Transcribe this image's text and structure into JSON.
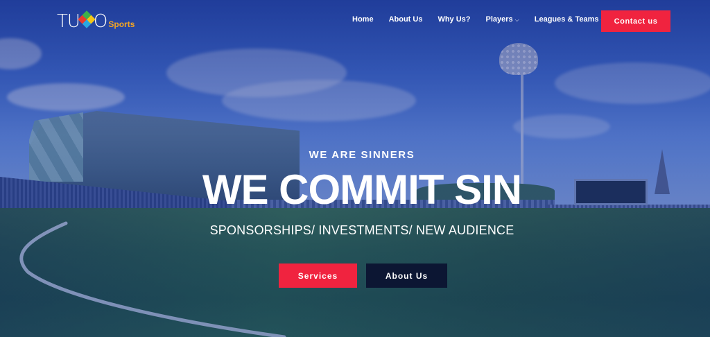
{
  "brand": {
    "logo_text": "TUGO",
    "logo_sub": "Sports"
  },
  "nav": {
    "items": [
      {
        "label": "Home",
        "dropdown": false
      },
      {
        "label": "About Us",
        "dropdown": false
      },
      {
        "label": "Why Us?",
        "dropdown": false
      },
      {
        "label": "Players",
        "dropdown": true
      },
      {
        "label": "Leagues & Teams",
        "dropdown": true
      }
    ],
    "chevron": "⌵",
    "contact_label": "Contact us"
  },
  "hero": {
    "eyebrow": "WE ARE SINNERS",
    "headline": "WE COMMIT SIN",
    "tagline": "SPONSORSHIPS/ INVESTMENTS/ NEW AUDIENCE",
    "primary_button": "Services",
    "secondary_button": "About Us"
  },
  "colors": {
    "accent": "#f0233f",
    "dark_button": "#0c1633",
    "overlay": "#1e3a96",
    "logo_sub": "#f5a623"
  }
}
